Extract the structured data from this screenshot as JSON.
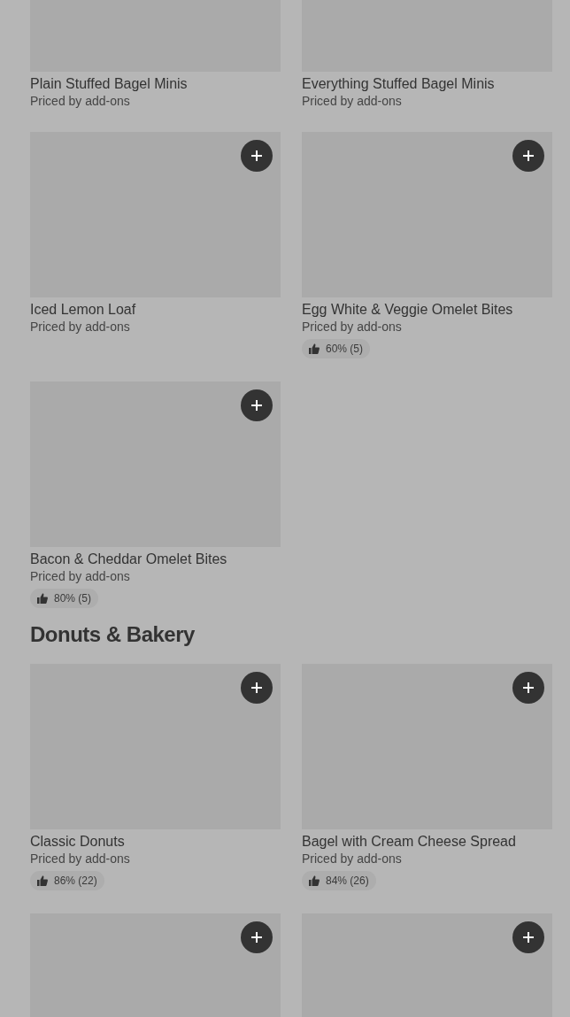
{
  "sections": [
    {
      "items": [
        {
          "name": "Plain Stuffed Bagel Minis",
          "price": "Priced by add-ons",
          "add_button": false
        },
        {
          "name": "Everything Stuffed Bagel Minis",
          "price": "Priced by add-ons",
          "add_button": false
        },
        {
          "name": "Iced Lemon Loaf",
          "price": "Priced by add-ons",
          "add_button": true
        },
        {
          "name": "Egg White & Veggie Omelet Bites",
          "price": "Priced by add-ons",
          "add_button": true,
          "rating": "60% (5)"
        },
        {
          "name": "Bacon & Cheddar Omelet Bites",
          "price": "Priced by add-ons",
          "add_button": true,
          "rating": "80% (5)"
        }
      ]
    },
    {
      "title": "Donuts & Bakery",
      "items": [
        {
          "name": "Classic Donuts",
          "price": "Priced by add-ons",
          "add_button": true,
          "rating": "86% (22)"
        },
        {
          "name": "Bagel with Cream Cheese Spread",
          "price": "Priced by add-ons",
          "add_button": true,
          "rating": "84% (26)"
        },
        {
          "add_button": true
        },
        {
          "add_button": true
        }
      ]
    }
  ]
}
